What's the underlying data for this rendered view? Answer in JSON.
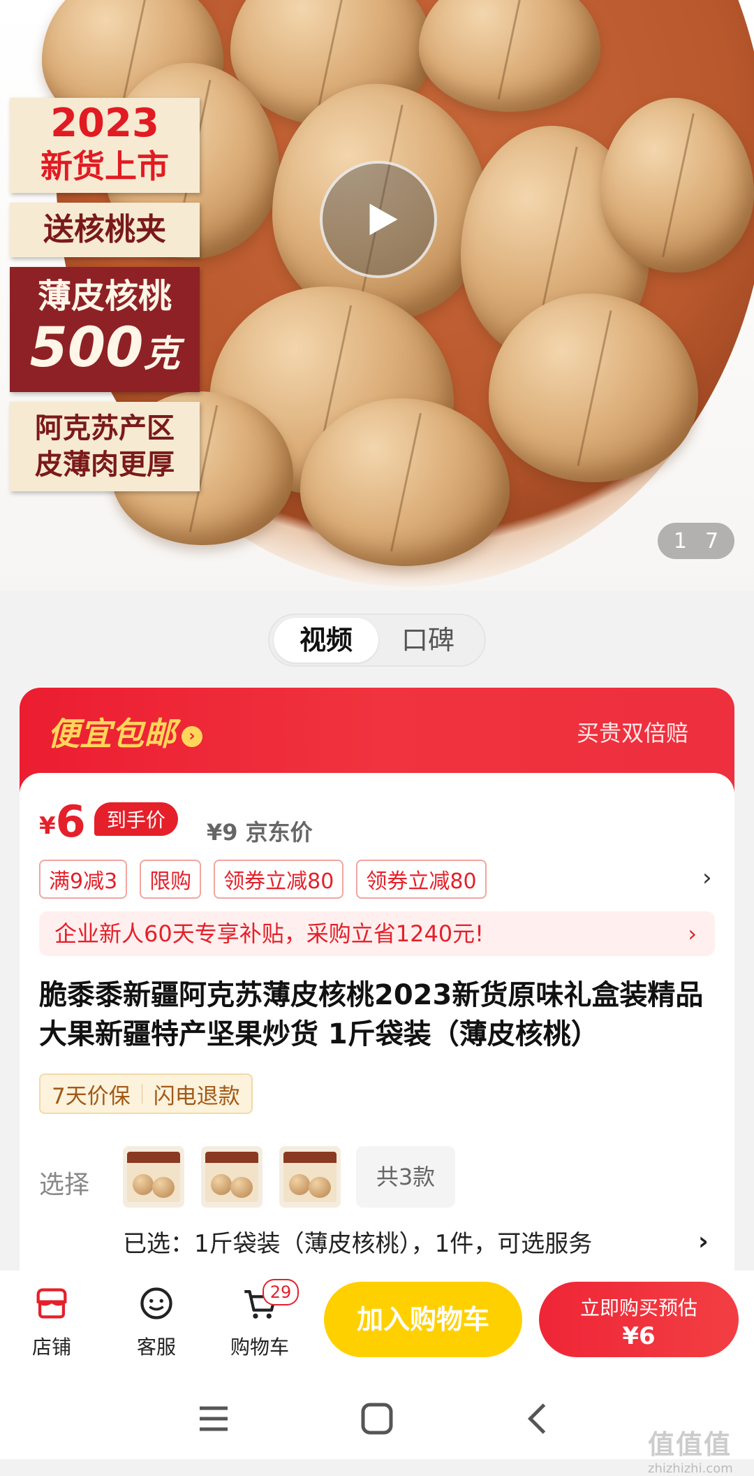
{
  "hero": {
    "promo_year": "2023",
    "promo_new": "新货上市",
    "promo_gift": "送核桃夹",
    "promo_type": "薄皮核桃",
    "promo_weight_num": "500",
    "promo_weight_unit": "克",
    "promo_origin_1": "阿克苏产区",
    "promo_origin_2": "皮薄肉更厚",
    "page_current": "1",
    "page_total": "7"
  },
  "media_tabs": [
    {
      "label": "视频",
      "active": true
    },
    {
      "label": "口碑",
      "active": false
    }
  ],
  "deal": {
    "title": "便宜包邮",
    "right_text": "买贵双倍赔"
  },
  "price": {
    "symbol": "¥",
    "value": "6",
    "badge": "到手价",
    "jd_price": "¥9 京东价"
  },
  "coupons": [
    "满9减3",
    "限购",
    "领券立减80",
    "领券立减80"
  ],
  "biz_banner": "企业新人60天专享补贴，采购立省1240元!",
  "product_title": "脆黍黍新疆阿克苏薄皮核桃2023新货原味礼盒装精品大果新疆特产坚果炒货 1斤袋装（薄皮核桃）",
  "guarantees": [
    "7天价保",
    "闪电退款"
  ],
  "selection": {
    "label": "选择",
    "total_styles": "共3款",
    "selected_text": "已选：1斤袋装（薄皮核桃），1件，可选服务"
  },
  "bottom_nav": {
    "store": "店铺",
    "service": "客服",
    "cart": "购物车",
    "cart_count": "29",
    "add_cart": "加入购物车",
    "buy_now_line1": "立即购买预估",
    "buy_now_line2": "¥6"
  },
  "watermark": {
    "cn": "值值值",
    "url": "zhizhizhi.com"
  },
  "colors": {
    "brand_red": "#e5202a",
    "cart_yellow": "#ffd000",
    "deal_yellow": "#ffd65a"
  }
}
